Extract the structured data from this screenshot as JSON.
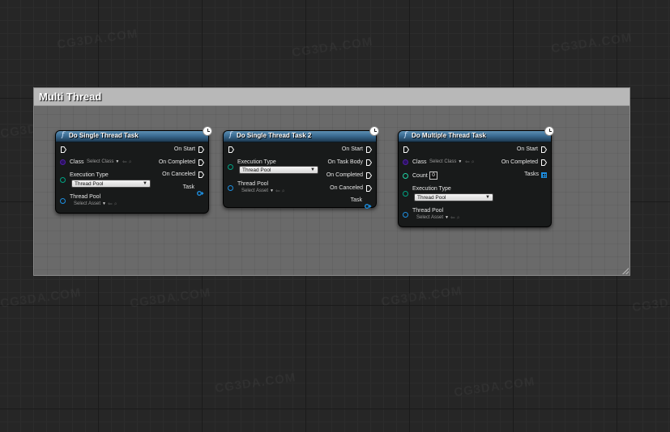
{
  "watermark": "CG3DA.COM",
  "comment": {
    "title": "Multi Thread"
  },
  "nodes": [
    {
      "title": "Do Single Thread Task",
      "outputs": [
        "On Start",
        "On Completed",
        "On Canceled",
        "Task"
      ],
      "inputs": {
        "class_label": "Class",
        "class_select": "Select Class",
        "exec_type_label": "Execution Type",
        "exec_type_value": "Thread Pool",
        "thread_pool_label": "Thread Pool",
        "thread_pool_select": "Select Asset"
      }
    },
    {
      "title": "Do Single Thread Task 2",
      "outputs": [
        "On Start",
        "On Task Body",
        "On Completed",
        "On Canceled",
        "Task"
      ],
      "inputs": {
        "exec_type_label": "Execution Type",
        "exec_type_value": "Thread Pool",
        "thread_pool_label": "Thread Pool",
        "thread_pool_select": "Select Asset"
      }
    },
    {
      "title": "Do Multiple Thread Task",
      "outputs": [
        "On Start",
        "On Completed",
        "Tasks"
      ],
      "inputs": {
        "class_label": "Class",
        "class_select": "Select Class",
        "count_label": "Count",
        "count_value": "0",
        "exec_type_label": "Execution Type",
        "exec_type_value": "Thread Pool",
        "thread_pool_label": "Thread Pool",
        "thread_pool_select": "Select Asset"
      }
    }
  ],
  "icons": {
    "function": "function-icon",
    "latent": "clock-icon",
    "exec": "exec-pin-icon",
    "browse": "browse-icon",
    "use": "use-selected-icon"
  },
  "colors": {
    "node_header": "#3b6c93",
    "class_pin": "#4f1ea4",
    "enum_pin": "#00a383",
    "object_pin": "#1d8fe1",
    "comment_bg": "#6a6a6a"
  }
}
